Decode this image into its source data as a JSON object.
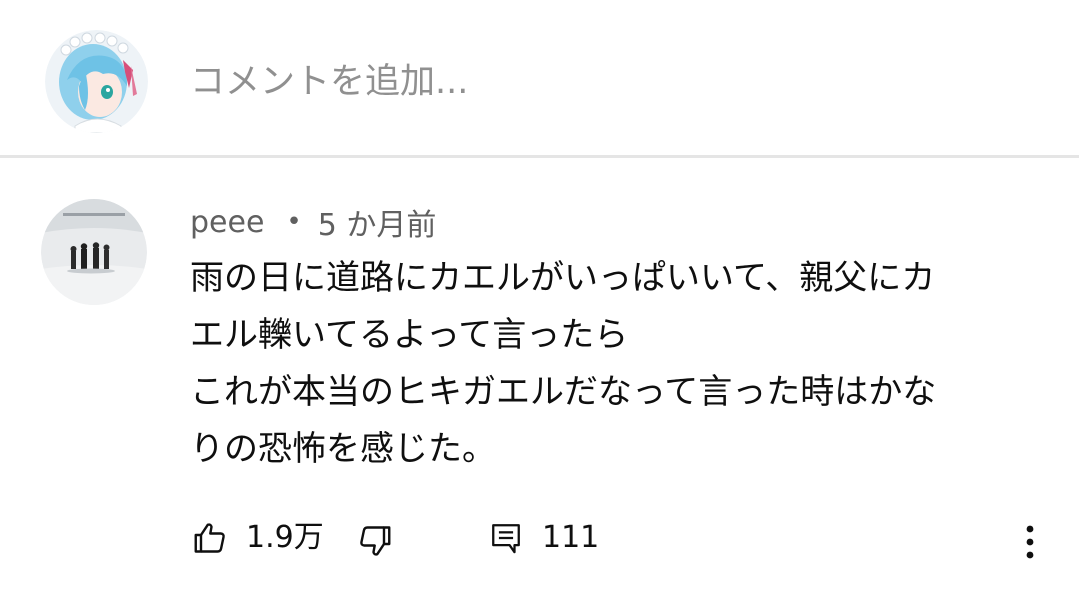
{
  "add_comment": {
    "placeholder": "コメントを追加..."
  },
  "comment": {
    "author": "peee",
    "separator": "•",
    "timestamp": "5 か月前",
    "text_lines": [
      "雨の日に道路にカエルがいっぱいいて、親父にカ",
      "エル轢いてるよって言ったら",
      "これが本当のヒキガエルだなって言った時はかな",
      "りの恐怖を感じた。"
    ],
    "likes": "1.9万",
    "replies": "111"
  },
  "icons": {
    "like": "thumbs-up-icon",
    "dislike": "thumbs-down-icon",
    "reply": "comment-icon",
    "more": "more-vertical-icon"
  },
  "colors": {
    "text_primary": "#0f0f0f",
    "text_secondary": "#606060",
    "placeholder": "#909090",
    "divider": "#e5e5e5",
    "avatar_hair": "#7ec8e8"
  }
}
